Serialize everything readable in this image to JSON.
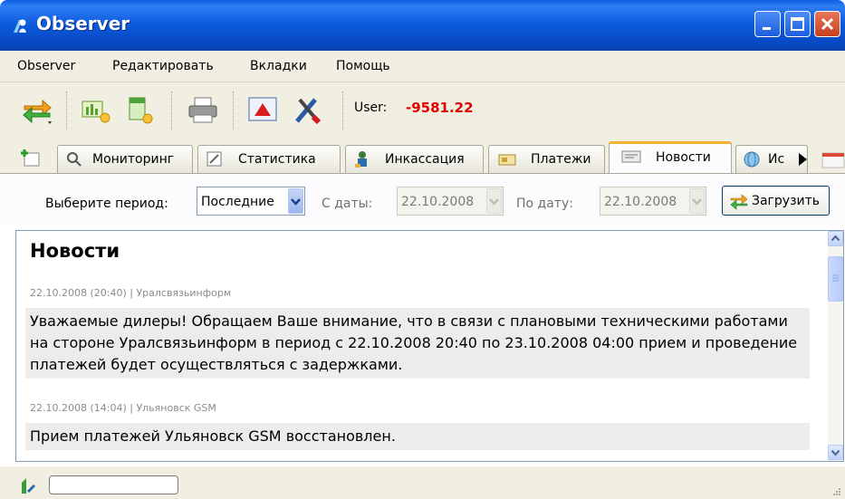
{
  "window": {
    "title": "Observer",
    "app_icon": "observer-logo-icon"
  },
  "menu": [
    "Observer",
    "Редактировать",
    "Вкладки",
    "Помощь"
  ],
  "toolbar": {
    "icons": [
      "refresh-arrows-icon",
      "add-report-icon",
      "add-document-icon",
      "printer-icon",
      "alert-icon",
      "tools-icon"
    ],
    "user_label": "User:",
    "user_value": "-9581.22"
  },
  "tabs": [
    {
      "label": "Мониторинг",
      "icon": "search-icon"
    },
    {
      "label": "Статистика",
      "icon": "chart-icon"
    },
    {
      "label": "Инкассация",
      "icon": "collection-icon"
    },
    {
      "label": "Платежи",
      "icon": "payments-icon"
    },
    {
      "label": "Новости",
      "icon": "news-icon",
      "active": true
    },
    {
      "label": "Ис",
      "icon": "globe-icon"
    }
  ],
  "filter": {
    "period_label": "Выберите период:",
    "period_value": "Последние",
    "from_label": "С даты:",
    "from_value": "22.10.2008",
    "to_label": "По дату:",
    "to_value": "22.10.2008",
    "load_label": "Загрузить"
  },
  "news": {
    "heading": "Новости",
    "items": [
      {
        "meta": "22.10.2008 (20:40) | Уралсвязьинформ",
        "body": "Уважаемые дилеры! Обращаем Ваше внимание, что в связи с плановыми техническими работами на стороне Уралсвязьинформ в период с 22.10.2008 20:40 по 23.10.2008 04:00 прием и проведение платежей будет осуществляться с задержками."
      },
      {
        "meta": "22.10.2008 (14:04) | Ульяновск GSM",
        "body": "Прием платежей Ульяновск GSM восстановлен."
      }
    ]
  },
  "colors": {
    "user_value": "#e00000",
    "active_tab_accent": "#f4b232",
    "titlebar": "#0b59dc"
  }
}
